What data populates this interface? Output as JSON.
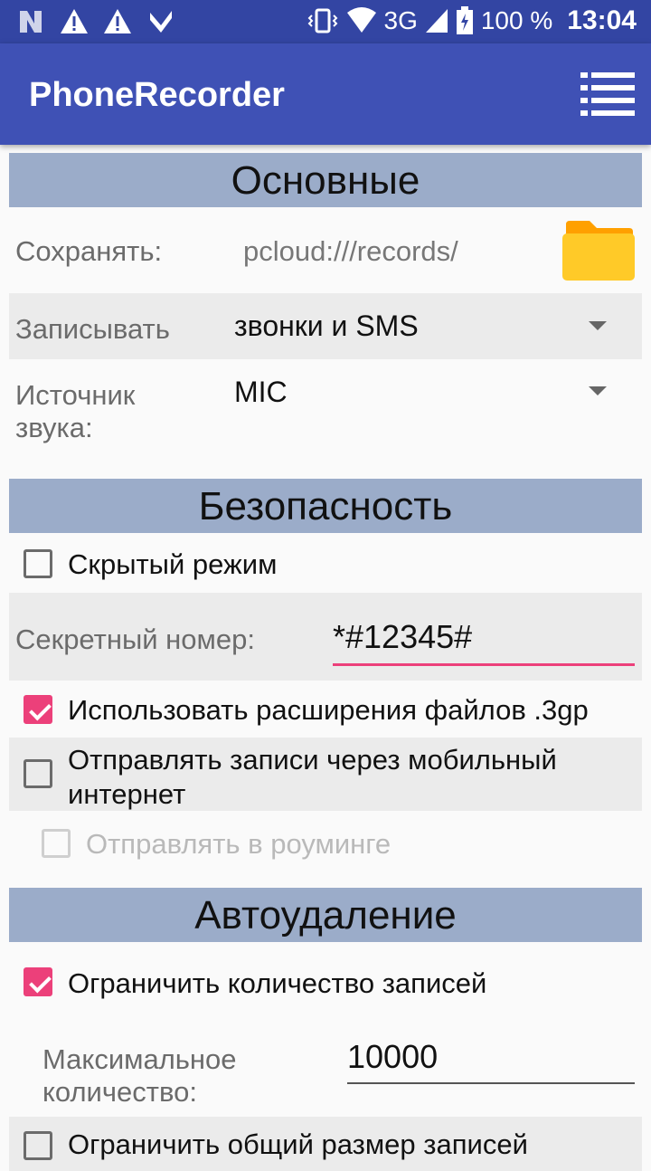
{
  "status_bar": {
    "battery_text": "100 %",
    "network_text": "3G",
    "time": "13:04",
    "icons": [
      "n-icon",
      "warning-icon",
      "warning-icon",
      "check-icon",
      "vibrate-icon",
      "wifi-icon",
      "signal-icon",
      "battery-icon"
    ]
  },
  "appbar": {
    "title": "PhoneRecorder",
    "menu_icon": "list-menu-icon"
  },
  "sections": {
    "main": "Основные",
    "security": "Безопасность",
    "autodelete": "Автоудаление"
  },
  "main": {
    "save_label": "Сохранять:",
    "save_path": "pcloud:///records/",
    "folder_icon": "folder-icon",
    "record_label": "Записывать",
    "record_value": "звонки и SMS",
    "source_label_line1": "Источник",
    "source_label_line2": "звука:",
    "source_value": "MIC"
  },
  "security": {
    "hidden_mode": {
      "label": "Скрытый режим",
      "checked": false
    },
    "secret_label": "Секретный номер:",
    "secret_value": "*#12345#",
    "use_3gp": {
      "label": "Использовать расширения файлов .3gp",
      "checked": true
    },
    "mobile_send": {
      "label_line1": "Отправлять записи через мобильный",
      "label_line2": "интернет",
      "checked": false
    },
    "roaming": {
      "label": "Отправлять в роуминге",
      "checked": false,
      "disabled": true
    }
  },
  "autodelete": {
    "limit_count": {
      "label": "Ограничить количество записей",
      "checked": true
    },
    "max_label_line1": "Максимальное",
    "max_label_line2": "количество:",
    "max_value": "10000",
    "limit_size": {
      "label": "Ограничить общий размер записей",
      "checked": false
    }
  },
  "colors": {
    "statusbar": "#3345a3",
    "appbar": "#3f51b5",
    "section_header": "#9bacc9",
    "accent": "#ec407a",
    "folder": "#ffca28"
  }
}
